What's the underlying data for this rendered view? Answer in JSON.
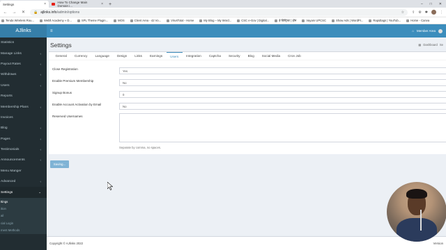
{
  "browser": {
    "tabs": [
      {
        "label": "Settings",
        "active": true
      },
      {
        "label": "How To Change Main Domain i...",
        "active": false
      }
    ],
    "new_tab": "+",
    "window_controls": [
      "–",
      "□",
      "✕"
    ],
    "url_host": "ajlinks.info",
    "url_path": "/admin/options",
    "bookmarks": [
      "Tenda Wireless Rou...",
      "Webll Academy » D...",
      "SPL Theme Plugin...",
      "MOS",
      "Client Area - 42 Vo...",
      "VirusTotal - Home",
      "My Blog – My Word...",
      "CSC e-Gov | Digital...",
      "ई-डिस्ट्रिक्ट | होम",
      "Vayam UPCSC",
      "Show Ads | WordPr...",
      "Rapidtags | YouTub...",
      "Home - Canva"
    ]
  },
  "app": {
    "logo": "AJlinks",
    "hamburger": "≡",
    "member_area": "Member Area"
  },
  "sidebar": {
    "items": [
      {
        "label": "Statistics",
        "chev": ""
      },
      {
        "label": "Manage Links",
        "chev": "‹"
      },
      {
        "label": "Payout Rates",
        "chev": "‹"
      },
      {
        "label": "Withdraws",
        "chev": "‹"
      },
      {
        "label": "Users",
        "chev": "‹"
      },
      {
        "label": "Reports",
        "chev": ""
      },
      {
        "label": "Membership Plans",
        "chev": "‹"
      },
      {
        "label": "Invoices",
        "chev": ""
      },
      {
        "label": "Blog",
        "chev": "‹"
      },
      {
        "label": "Pages",
        "chev": "‹"
      },
      {
        "label": "Testimonials",
        "chev": "‹"
      },
      {
        "label": "Announcements",
        "chev": "‹"
      },
      {
        "label": "Menu Manger",
        "chev": ""
      },
      {
        "label": "Advanced",
        "chev": "‹"
      }
    ],
    "settings": {
      "label": "Settings",
      "chev": "⌄"
    },
    "sub_items": [
      "ttings",
      "ition",
      "ail",
      "cial Login",
      "ment Methods"
    ]
  },
  "content": {
    "title": "Settings",
    "breadcrumb": [
      "Dashboard",
      "Se"
    ],
    "tabs": [
      "General",
      "Currency",
      "Language",
      "Design",
      "Links",
      "Earnings",
      "Users",
      "Integration",
      "Captcha",
      "Security",
      "Blog",
      "Social Media",
      "Cron Job"
    ],
    "active_tab": "Users",
    "fields": {
      "close_registration": {
        "label": "Close Registration",
        "value": "Yes"
      },
      "enable_premium": {
        "label": "Enable Premium Membership",
        "value": "No"
      },
      "signup_bonus": {
        "label": "Signup Bonus",
        "value": "0"
      },
      "account_activation": {
        "label": "Enable Account Activation by Email",
        "value": "No"
      },
      "reserved_usernames": {
        "label": "Reserved Usernames",
        "value": "",
        "help": "Separate by comma, no spaces."
      }
    },
    "save_button": "Saving..."
  },
  "footer": {
    "copyright": "Copyright © AJlinks 2022",
    "version": "Version"
  },
  "colors": {
    "header": "#3c8dbc",
    "logo_bg": "#367fa9",
    "sidebar": "#222d32",
    "saving_button": "#7fb3d5"
  }
}
